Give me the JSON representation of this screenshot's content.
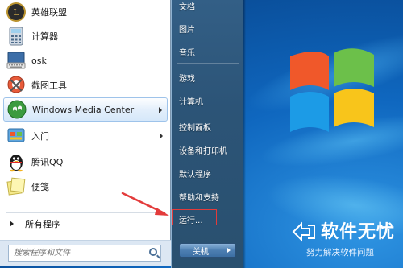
{
  "programs": [
    {
      "label": "英雄联盟",
      "icon": "league-of-legends-icon",
      "submenu": false
    },
    {
      "label": "计算器",
      "icon": "calculator-icon",
      "submenu": false
    },
    {
      "label": "osk",
      "icon": "on-screen-keyboard-icon",
      "submenu": false
    },
    {
      "label": "截图工具",
      "icon": "snipping-tool-icon",
      "submenu": false
    },
    {
      "label": "Windows Media Center",
      "icon": "windows-media-center-icon",
      "submenu": true
    },
    {
      "label": "入门",
      "icon": "getting-started-icon",
      "submenu": true
    },
    {
      "label": "腾讯QQ",
      "icon": "qq-penguin-icon",
      "submenu": false
    },
    {
      "label": "便笺",
      "icon": "sticky-notes-icon",
      "submenu": false
    }
  ],
  "all_programs_label": "所有程序",
  "search": {
    "placeholder": "搜索程序和文件",
    "icon": "search-icon"
  },
  "right_items": {
    "documents": "文档",
    "pictures": "图片",
    "music": "音乐",
    "games": "游戏",
    "computer": "计算机",
    "control_panel": "控制面板",
    "devices_printers": "设备和打印机",
    "default_programs": "默认程序",
    "help_support": "帮助和支持",
    "run": "运行..."
  },
  "shutdown": {
    "label": "关机",
    "icon": "shutdown-options-arrow-icon"
  },
  "watermark": {
    "title": "软件无忧",
    "subtitle": "努力解决软件问题"
  },
  "colors": {
    "annotation": "#e33b3b",
    "right_pane": "#2c5477",
    "desktop": "#0f67bf"
  }
}
